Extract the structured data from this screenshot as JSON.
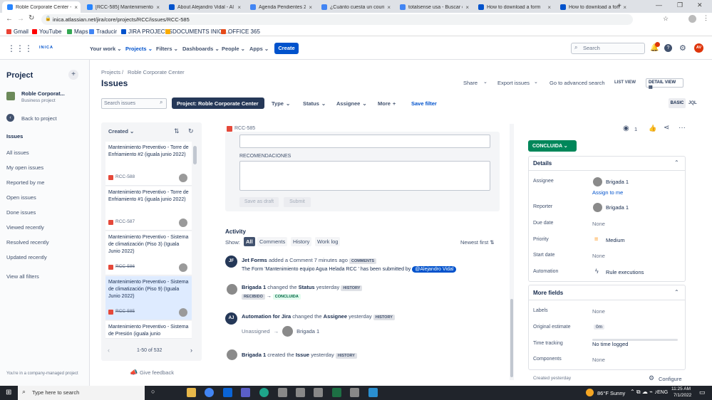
{
  "browser": {
    "tabs": [
      {
        "title": "Roble Corporate Center - I",
        "color": "#2684ff",
        "active": true
      },
      {
        "title": "[RCC-585] Mantenimiento",
        "color": "#2684ff"
      },
      {
        "title": "About Alejandro Vidal - Al",
        "color": "#0052cc"
      },
      {
        "title": "Agenda Pendientes 2022",
        "color": "#4285f4"
      },
      {
        "title": "¿Cuánto cuesta un courier",
        "color": "#4285f4"
      },
      {
        "title": "totalsense usa - Buscar co",
        "color": "#4285f4"
      },
      {
        "title": "How to download a form",
        "color": "#0052cc"
      },
      {
        "title": "How to download a form",
        "color": "#0052cc"
      }
    ],
    "url": "inica.atlassian.net/jira/core/projects/RCC/issues/RCC-585",
    "bookmarks": [
      "Gmail",
      "YouTube",
      "Maps",
      "Traducir",
      "JIRA PROJECTS",
      "DOCUMENTS INICA...",
      "OFFICE 365"
    ]
  },
  "nav": {
    "items": [
      "Your work",
      "Projects",
      "Filters",
      "Dashboards",
      "People",
      "Apps"
    ],
    "create": "Create",
    "search_placeholder": "Search",
    "avatar": "AV",
    "logo": "INICA"
  },
  "sidebar": {
    "title": "Project",
    "project_name": "Roble Corporat...",
    "project_type": "Business project",
    "back": "Back to project",
    "section": "Issues",
    "items": [
      "All issues",
      "My open issues",
      "Reported by me",
      "Open issues",
      "Done issues",
      "Viewed recently",
      "Resolved recently",
      "Updated recently"
    ],
    "view_all": "View all filters",
    "footer": "You're in a company-managed project",
    "feedback": "Give feedback"
  },
  "main": {
    "breadcrumb": [
      "Projects",
      "Roble Corporate Center"
    ],
    "title": "Issues",
    "actions": [
      "Share",
      "Export issues",
      "Go to advanced search"
    ],
    "list_view": "LIST VIEW",
    "detail_view": "DETAIL VIEW",
    "search_placeholder": "Search issues",
    "project_filter": "Project: Roble Corporate Center",
    "filters": [
      "Type",
      "Status",
      "Assignee",
      "More"
    ],
    "save_filter": "Save filter",
    "basic": "BASIC",
    "jql": "JQL",
    "sort": "Created",
    "pagination": "1-50 of 532"
  },
  "issues": [
    {
      "title": "Mantenimiento Preventivo - Torre de Enfriamiento #2 (iguala junio 2022)",
      "key": "RCC-588",
      "struck": false,
      "selected": false
    },
    {
      "title": "Mantenimiento Preventivo - Torre de Enfriamiento #1 (iguala junio 2022)",
      "key": "RCC-587",
      "struck": false,
      "selected": false
    },
    {
      "title": "Mantenimiento Preventivo - Sistema de climatización (Piso 3) (Iguala Junio 2022)",
      "key": "RCC-586",
      "struck": true,
      "selected": false
    },
    {
      "title": "Mantenimiento Preventivo - Sistema de climatización (Piso 9) (Iguala Junio 2022)",
      "key": "RCC-585",
      "struck": true,
      "selected": true
    },
    {
      "title": "Mantenimiento Preventivo - Sistema de Presión (iguala junio",
      "key": "",
      "struck": false,
      "selected": false
    }
  ],
  "detail": {
    "key": "RCC-585",
    "recommendations_label": "RECOMENDACIONES",
    "save_draft": "Save as draft",
    "submit": "Submit",
    "watchers": "1",
    "status": "CONCLUIDA",
    "activity": {
      "title": "Activity",
      "show": "Show:",
      "tabs": [
        "All",
        "Comments",
        "History",
        "Work log"
      ],
      "sort": "Newest first",
      "entries": [
        {
          "author": "Jet Forms",
          "action": "added a Comment",
          "time": "7 minutes ago",
          "tag": "COMMENTS",
          "initials": "JF",
          "body": "The Form 'Mantenimiento equipo Agua Helada RCC ' has been submitted by",
          "mention": "@Alejandro Vidal"
        },
        {
          "author": "Brigada 1",
          "action": "changed the",
          "field": "Status",
          "time": "yesterday",
          "tag": "HISTORY",
          "from": "RECIBIDO",
          "to": "CONCLUIDA"
        },
        {
          "author": "Automation for Jira",
          "action": "changed the",
          "field": "Assignee",
          "time": "yesterday",
          "tag": "HISTORY",
          "initials": "AJ",
          "from": "Unassigned",
          "to": "Brigada 1"
        },
        {
          "author": "Brigada 1",
          "action": "created the",
          "field": "Issue",
          "time": "yesterday",
          "tag": "HISTORY"
        }
      ]
    },
    "details_title": "Details",
    "fields": [
      {
        "label": "Assignee",
        "value": "Brigada 1",
        "extra": "Assign to me"
      },
      {
        "label": "Reporter",
        "value": "Brigada 1"
      },
      {
        "label": "Due date",
        "value": "None"
      },
      {
        "label": "Priority",
        "value": "Medium"
      },
      {
        "label": "Start date",
        "value": "None"
      },
      {
        "label": "Automation",
        "value": "Rule executions"
      }
    ],
    "more_fields_title": "More fields",
    "more_fields": [
      {
        "label": "Labels",
        "value": "None"
      },
      {
        "label": "Original estimate",
        "value": "0m"
      },
      {
        "label": "Time tracking",
        "value": "No time logged"
      },
      {
        "label": "Components",
        "value": "None"
      }
    ],
    "created": "Created yesterday",
    "configure": "Configure"
  },
  "taskbar": {
    "search": "Type here to search",
    "weather": "86°F  Sunny",
    "lang": "ENG",
    "time": "11:25 AM",
    "date": "7/1/2022"
  }
}
